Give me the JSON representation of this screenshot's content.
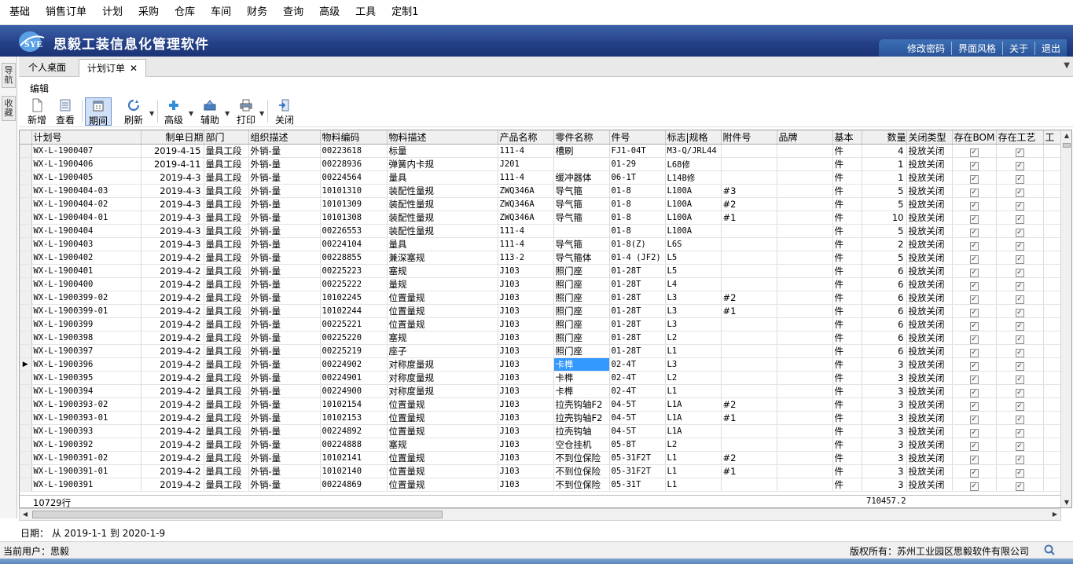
{
  "menu": [
    "基础",
    "销售订单",
    "计划",
    "采购",
    "仓库",
    "车间",
    "财务",
    "查询",
    "高级",
    "工具",
    "定制1"
  ],
  "app": {
    "title": "思毅工装信息化管理软件",
    "logo_text": "SYE"
  },
  "top_links": [
    "修改密码",
    "界面风格",
    "关于",
    "退出"
  ],
  "left_strip": {
    "nav_label": "导航",
    "collapse_label": "收藏"
  },
  "tabs": [
    {
      "label": "个人桌面"
    },
    {
      "label": "计划订单",
      "close": "✕"
    }
  ],
  "edit_label": "编辑",
  "toolbar": {
    "new": "新增",
    "view": "查看",
    "period": "期间",
    "refresh": "刷新",
    "advanced": "高级",
    "assist": "辅助",
    "print": "打印",
    "close": "关闭"
  },
  "grid": {
    "columns": [
      "计划号",
      "制单日期",
      "部门",
      "组织描述",
      "物料编码",
      "物料描述",
      "产品名称",
      "零件名称",
      "件号",
      "标志|规格",
      "附件号",
      "品牌",
      "基本",
      "数量",
      "关闭类型",
      "存在BOM",
      "存在工艺",
      "工"
    ],
    "rows": [
      [
        "WX-L-1900407",
        "2019-4-15",
        "量具工段",
        "外销-量",
        "00223618",
        "标量",
        "111-4",
        "槽刷",
        "FJ1-04T",
        "M3-Q/JRL44",
        "",
        "",
        "件",
        "4",
        "投放关闭"
      ],
      [
        "WX-L-1900406",
        "2019-4-11",
        "量具工段",
        "外销-量",
        "00228936",
        "弹簧内卡规",
        "J201",
        "",
        "01-29",
        "L68修",
        "",
        "",
        "件",
        "1",
        "投放关闭"
      ],
      [
        "WX-L-1900405",
        "2019-4-3",
        "量具工段",
        "外销-量",
        "00224564",
        "量具",
        "111-4",
        "缓冲器体",
        "06-1T",
        "L14B修",
        "",
        "",
        "件",
        "1",
        "投放关闭"
      ],
      [
        "WX-L-1900404-03",
        "2019-4-3",
        "量具工段",
        "外销-量",
        "10101310",
        "装配性量规",
        "ZWQ346A",
        "导气箍",
        "01-8",
        "L100A",
        "#3",
        "",
        "件",
        "5",
        "投放关闭"
      ],
      [
        "WX-L-1900404-02",
        "2019-4-3",
        "量具工段",
        "外销-量",
        "10101309",
        "装配性量规",
        "ZWQ346A",
        "导气箍",
        "01-8",
        "L100A",
        "#2",
        "",
        "件",
        "5",
        "投放关闭"
      ],
      [
        "WX-L-1900404-01",
        "2019-4-3",
        "量具工段",
        "外销-量",
        "10101308",
        "装配性量规",
        "ZWQ346A",
        "导气箍",
        "01-8",
        "L100A",
        "#1",
        "",
        "件",
        "10",
        "投放关闭"
      ],
      [
        "WX-L-1900404",
        "2019-4-3",
        "量具工段",
        "外销-量",
        "00226553",
        "装配性量规",
        "111-4",
        "",
        "01-8",
        "L100A",
        "",
        "",
        "件",
        "5",
        "投放关闭"
      ],
      [
        "WX-L-1900403",
        "2019-4-3",
        "量具工段",
        "外销-量",
        "00224104",
        "量具",
        "111-4",
        "导气箍",
        "01-8(Z)",
        "L6S",
        "",
        "",
        "件",
        "2",
        "投放关闭"
      ],
      [
        "WX-L-1900402",
        "2019-4-2",
        "量具工段",
        "外销-量",
        "00228855",
        "兼深塞规",
        "113-2",
        "导气箍体",
        "01-4 (JF2)",
        "L5",
        "",
        "",
        "件",
        "5",
        "投放关闭"
      ],
      [
        "WX-L-1900401",
        "2019-4-2",
        "量具工段",
        "外销-量",
        "00225223",
        "塞规",
        "J103",
        "照门座",
        "01-28T",
        "L5",
        "",
        "",
        "件",
        "6",
        "投放关闭"
      ],
      [
        "WX-L-1900400",
        "2019-4-2",
        "量具工段",
        "外销-量",
        "00225222",
        "量规",
        "J103",
        "照门座",
        "01-28T",
        "L4",
        "",
        "",
        "件",
        "6",
        "投放关闭"
      ],
      [
        "WX-L-1900399-02",
        "2019-4-2",
        "量具工段",
        "外销-量",
        "10102245",
        "位置量规",
        "J103",
        "照门座",
        "01-28T",
        "L3",
        "#2",
        "",
        "件",
        "6",
        "投放关闭"
      ],
      [
        "WX-L-1900399-01",
        "2019-4-2",
        "量具工段",
        "外销-量",
        "10102244",
        "位置量规",
        "J103",
        "照门座",
        "01-28T",
        "L3",
        "#1",
        "",
        "件",
        "6",
        "投放关闭"
      ],
      [
        "WX-L-1900399",
        "2019-4-2",
        "量具工段",
        "外销-量",
        "00225221",
        "位置量规",
        "J103",
        "照门座",
        "01-28T",
        "L3",
        "",
        "",
        "件",
        "6",
        "投放关闭"
      ],
      [
        "WX-L-1900398",
        "2019-4-2",
        "量具工段",
        "外销-量",
        "00225220",
        "塞规",
        "J103",
        "照门座",
        "01-28T",
        "L2",
        "",
        "",
        "件",
        "6",
        "投放关闭"
      ],
      [
        "WX-L-1900397",
        "2019-4-2",
        "量具工段",
        "外销-量",
        "00225219",
        "座子",
        "J103",
        "照门座",
        "01-28T",
        "L1",
        "",
        "",
        "件",
        "6",
        "投放关闭"
      ],
      [
        "WX-L-1900396",
        "2019-4-2",
        "量具工段",
        "外销-量",
        "00224902",
        "对称度量规",
        "J103",
        "卡榫",
        "02-4T",
        "L3",
        "",
        "",
        "件",
        "3",
        "投放关闭"
      ],
      [
        "WX-L-1900395",
        "2019-4-2",
        "量具工段",
        "外销-量",
        "00224901",
        "对称度量规",
        "J103",
        "卡榫",
        "02-4T",
        "L2",
        "",
        "",
        "件",
        "3",
        "投放关闭"
      ],
      [
        "WX-L-1900394",
        "2019-4-2",
        "量具工段",
        "外销-量",
        "00224900",
        "对称度量规",
        "J103",
        "卡榫",
        "02-4T",
        "L1",
        "",
        "",
        "件",
        "3",
        "投放关闭"
      ],
      [
        "WX-L-1900393-02",
        "2019-4-2",
        "量具工段",
        "外销-量",
        "10102154",
        "位置量规",
        "J103",
        "拉壳钩轴F2",
        "04-5T",
        "L1A",
        "#2",
        "",
        "件",
        "3",
        "投放关闭"
      ],
      [
        "WX-L-1900393-01",
        "2019-4-2",
        "量具工段",
        "外销-量",
        "10102153",
        "位置量规",
        "J103",
        "拉壳钩轴F2",
        "04-5T",
        "L1A",
        "#1",
        "",
        "件",
        "3",
        "投放关闭"
      ],
      [
        "WX-L-1900393",
        "2019-4-2",
        "量具工段",
        "外销-量",
        "00224892",
        "位置量规",
        "J103",
        "拉壳钩轴",
        "04-5T",
        "L1A",
        "",
        "",
        "件",
        "3",
        "投放关闭"
      ],
      [
        "WX-L-1900392",
        "2019-4-2",
        "量具工段",
        "外销-量",
        "00224888",
        "塞规",
        "J103",
        "空仓挂机",
        "05-8T",
        "L2",
        "",
        "",
        "件",
        "3",
        "投放关闭"
      ],
      [
        "WX-L-1900391-02",
        "2019-4-2",
        "量具工段",
        "外销-量",
        "10102141",
        "位置量规",
        "J103",
        "不到位保险",
        "05-31F2T",
        "L1",
        "#2",
        "",
        "件",
        "3",
        "投放关闭"
      ],
      [
        "WX-L-1900391-01",
        "2019-4-2",
        "量具工段",
        "外销-量",
        "10102140",
        "位置量规",
        "J103",
        "不到位保险",
        "05-31F2T",
        "L1",
        "#1",
        "",
        "件",
        "3",
        "投放关闭"
      ],
      [
        "WX-L-1900391",
        "2019-4-2",
        "量具工段",
        "外销-量",
        "00224869",
        "位置量规",
        "J103",
        "不到位保险",
        "05-31T",
        "L1",
        "",
        "",
        "件",
        "3",
        "投放关闭"
      ]
    ],
    "selected_row": 16,
    "checked_mark": "✓",
    "row_count": "10729行",
    "qty_total": "710457.2"
  },
  "date_range": "日期： 从 2019-1-1 到 2020-1-9",
  "status": {
    "current_user": "当前用户：思毅",
    "copyright": "版权所有：苏州工业园区思毅软件有限公司"
  },
  "colors": {
    "banner": "#233f86",
    "selection": "#3399ff",
    "active_tool": "#cfe0f7"
  }
}
